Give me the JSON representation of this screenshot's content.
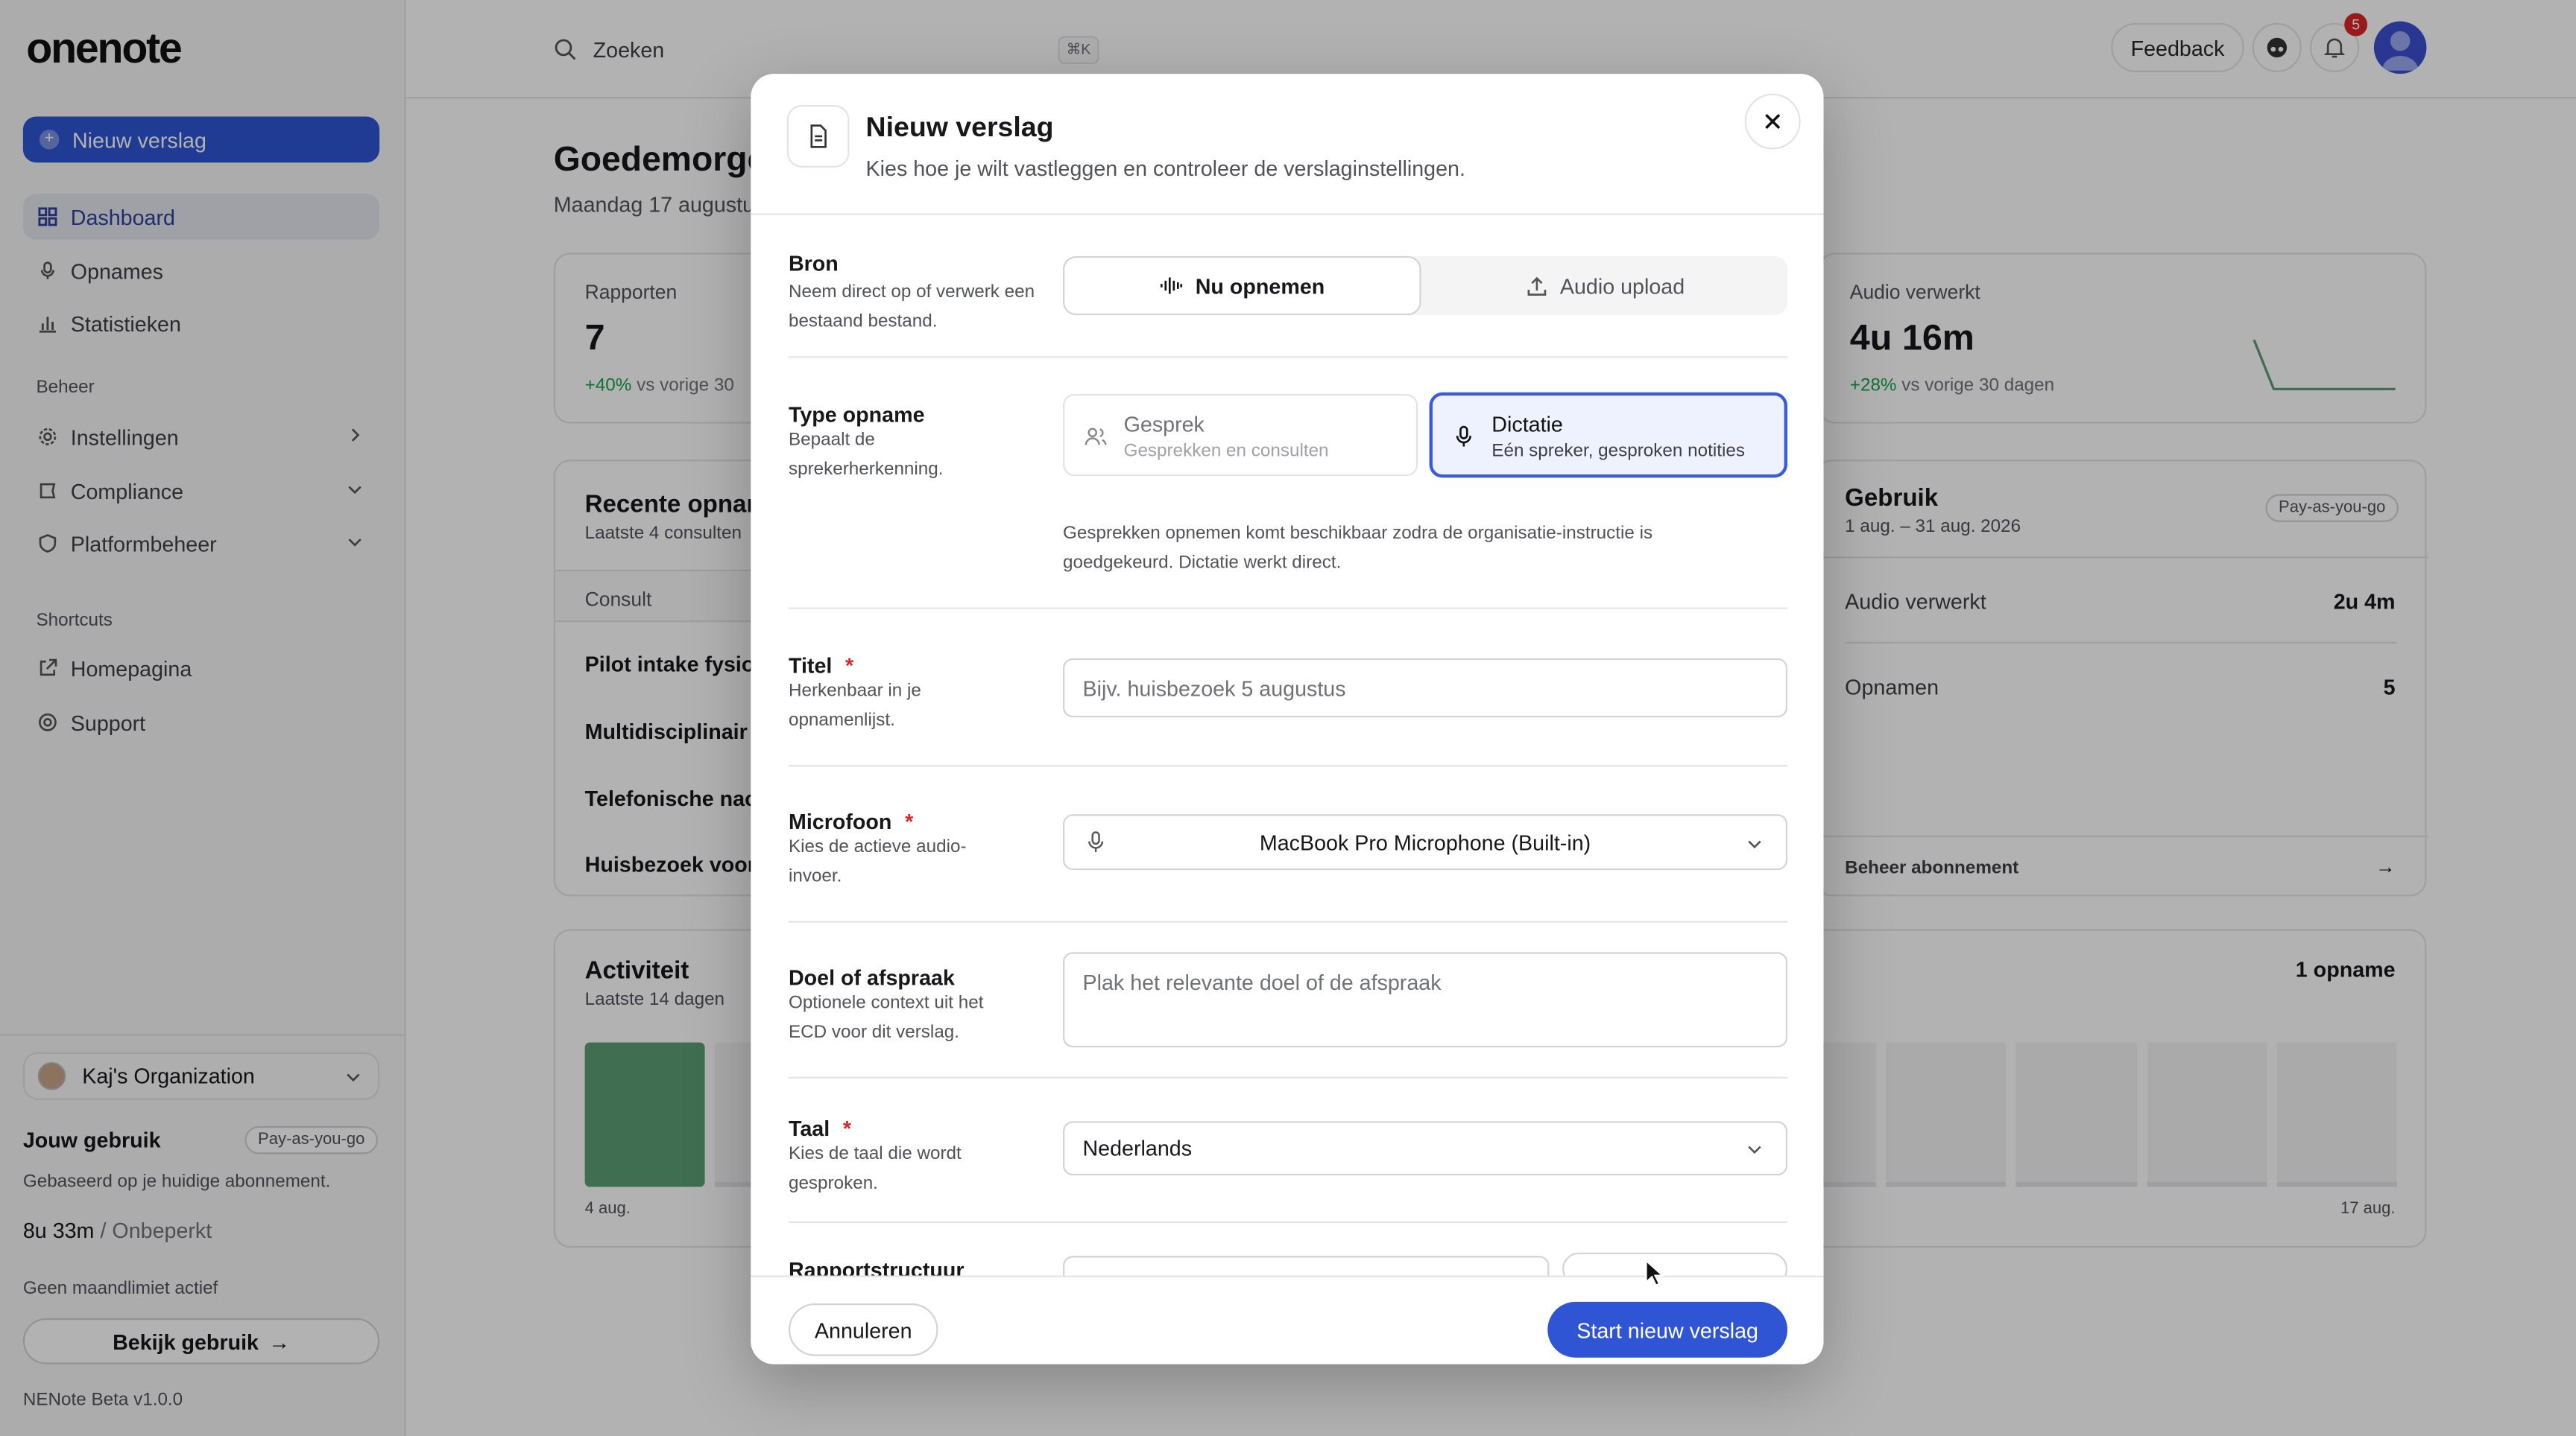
{
  "app": {
    "logo": "onenote"
  },
  "sidebar": {
    "new_report": "Nieuw verslag",
    "nav": [
      {
        "label": "Dashboard"
      },
      {
        "label": "Opnames"
      },
      {
        "label": "Statistieken"
      }
    ],
    "section_manage": "Beheer",
    "manage": [
      {
        "label": "Instellingen"
      },
      {
        "label": "Compliance"
      },
      {
        "label": "Platformbeheer"
      }
    ],
    "section_shortcuts": "Shortcuts",
    "shortcuts": [
      {
        "label": "Homepagina"
      },
      {
        "label": "Support"
      }
    ],
    "org": "Kaj's Organization",
    "usage_title": "Jouw gebruik",
    "usage_plan": "Pay-as-you-go",
    "usage_sub": "Gebaseerd op je huidige abonnement.",
    "usage_value": "8u 33m",
    "usage_sep": "/",
    "usage_limit": "Onbeperkt",
    "no_limit": "Geen maandlimiet actief",
    "view_usage": "Bekijk gebruik",
    "version": "NENote Beta v1.0.0"
  },
  "topbar": {
    "search_placeholder": "Zoeken",
    "shortcut": "⌘K",
    "feedback": "Feedback",
    "notifications": "5"
  },
  "dashboard": {
    "greeting": "Goedemorge",
    "date": "Maandag 17 augustu",
    "stat1": {
      "label": "Rapporten",
      "value": "7",
      "delta": "+40%",
      "delta_text": "vs vorige 30"
    },
    "stat2": {
      "label": "Audio verwerkt",
      "value": "4u 16m",
      "delta": "+28%",
      "delta_text": "vs vorige 30 dagen"
    },
    "recent": {
      "title": "Recente opnan",
      "sub": "Laatste 4 consulten",
      "col": "Consult",
      "rows": [
        "Pilot intake fysiot",
        "Multidisciplinair t",
        "Telefonische nac",
        "Huisbezoek voor"
      ]
    },
    "usage": {
      "title": "Gebruik",
      "period": "1 aug. – 31 aug. 2026",
      "plan": "Pay-as-you-go",
      "rows": [
        {
          "label": "Audio verwerkt",
          "value": "2u 4m"
        },
        {
          "label": "Opnamen",
          "value": "5"
        }
      ],
      "manage": "Beheer abonnement"
    },
    "activity": {
      "title": "Activiteit",
      "sub": "Laatste 14 dagen",
      "count": "1 opname",
      "start": "4 aug.",
      "end": "17 aug.",
      "bars": [
        1,
        0,
        0,
        0,
        0,
        0,
        0,
        0,
        0,
        0,
        0,
        0,
        0,
        0
      ],
      "bar_color": "#5b9e74"
    }
  },
  "modal": {
    "title": "Nieuw verslag",
    "subtitle": "Kies hoe je wilt vastleggen en controleer de verslaginstellingen.",
    "source": {
      "label": "Bron",
      "hint": "Neem direct op of verwerk een bestaand bestand.",
      "record": "Nu opnemen",
      "upload": "Audio upload"
    },
    "type": {
      "label": "Type opname",
      "hint": "Bepaalt de sprekerherkenning.",
      "conversation": {
        "title": "Gesprek",
        "sub": "Gesprekken en consulten"
      },
      "dictation": {
        "title": "Dictatie",
        "sub": "Eén spreker, gesproken notities"
      },
      "note": "Gesprekken opnemen komt beschikbaar zodra de organisatie-instructie is goedgekeurd. Dictatie werkt direct."
    },
    "title_field": {
      "label": "Titel",
      "required": "*",
      "hint": "Herkenbaar in je opnamenlijst.",
      "placeholder": "Bijv. huisbezoek 5 augustus"
    },
    "mic": {
      "label": "Microfoon",
      "required": "*",
      "hint": "Kies de actieve audio-invoer.",
      "value": "MacBook Pro Microphone (Built-in)"
    },
    "goal": {
      "label": "Doel of afspraak",
      "hint": "Optionele context uit het ECD voor dit verslag.",
      "placeholder": "Plak het relevante doel of de afspraak"
    },
    "lang": {
      "label": "Taal",
      "required": "*",
      "hint": "Kies de taal die wordt gesproken.",
      "value": "Nederlands"
    },
    "structure": {
      "label": "Rapportstructuur"
    },
    "cancel": "Annuleren",
    "start": "Start nieuw verslag"
  },
  "colors": {
    "accent": "#2f55d4",
    "danger": "#dc2626",
    "success": "#16a34a"
  }
}
